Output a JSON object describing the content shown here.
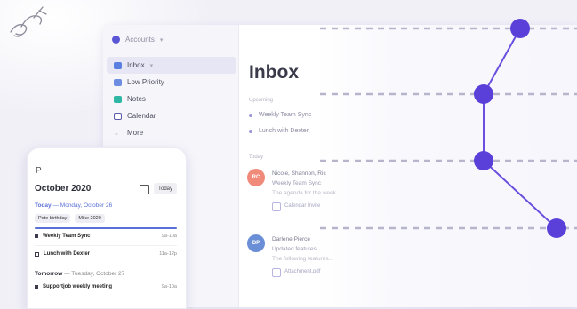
{
  "colors": {
    "accent": "#5b3fd9",
    "node": "#6a4ee0",
    "dash": "#b7b5cc",
    "calendar_blue": "#5b70d6"
  },
  "sidebar": {
    "account": "Accounts",
    "items": [
      {
        "label": "Inbox",
        "icon": "inbox-icon",
        "active": true
      },
      {
        "label": "Low Priority",
        "icon": "people-icon",
        "active": false
      },
      {
        "label": "Notes",
        "icon": "notes-icon",
        "active": false
      },
      {
        "label": "Calendar",
        "icon": "calendar-icon",
        "active": false
      },
      {
        "label": "More",
        "icon": "chevron-down-icon",
        "active": false
      }
    ]
  },
  "main": {
    "title": "Inbox",
    "upcoming_label": "Upcoming",
    "upcoming": [
      "Weekly Team Sync",
      "Lunch with Dexter"
    ],
    "today_label": "Today",
    "mails": [
      {
        "initials": "RC",
        "color": "#f08a7a",
        "sender": "Nicole, Shannon, Ric",
        "subject": "Weekly Team Sync",
        "preview": "The agenda for the week...",
        "chip": "Calendar Invite"
      },
      {
        "initials": "DP",
        "color": "#6b8fd6",
        "sender": "Darlene Pierce",
        "subject": "Updated features...",
        "preview": "The following features...",
        "chip": "Attachment.pdf"
      }
    ]
  },
  "phone": {
    "header_glyph": "P",
    "month": "October 2020",
    "today_button": "Today",
    "today_prefix": "Today",
    "today_date": " — Monday, October 26",
    "chips": [
      "Pete birthday",
      "Mike 2020"
    ],
    "events": [
      {
        "title": "Weekly Team Sync",
        "time": "9a-10a",
        "hollow": false
      },
      {
        "title": "Lunch with Dexter",
        "time": "11a-12p",
        "hollow": true
      }
    ],
    "tomorrow_prefix": "Tomorrow",
    "tomorrow_date": " — Tuesday, October 27",
    "tomorrow_events": [
      {
        "title": "Supportjob weekly meeting",
        "time": "9a-10a",
        "hollow": false
      }
    ]
  }
}
